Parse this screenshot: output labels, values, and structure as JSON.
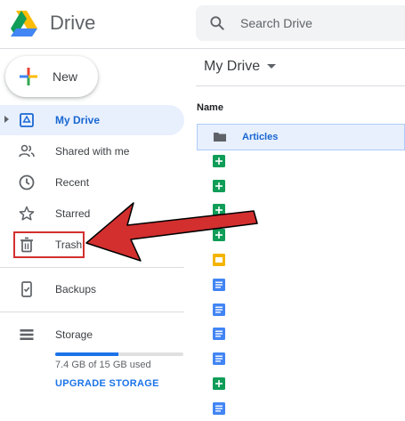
{
  "header": {
    "brand": "Drive",
    "logo_icon": "google-drive-logo",
    "search_placeholder": "Search Drive",
    "search_icon": "search-icon"
  },
  "sidebar": {
    "new_label": "New",
    "items": [
      {
        "label": "My Drive",
        "icon": "my-drive-icon",
        "active": true
      },
      {
        "label": "Shared with me",
        "icon": "people-icon"
      },
      {
        "label": "Recent",
        "icon": "clock-icon"
      },
      {
        "label": "Starred",
        "icon": "star-icon"
      },
      {
        "label": "Trash",
        "icon": "trash-icon",
        "highlighted": true
      },
      {
        "label": "Backups",
        "icon": "backup-icon"
      },
      {
        "label": "Storage",
        "icon": "storage-icon"
      }
    ],
    "storage": {
      "used_text": "7.4 GB of 15 GB used",
      "used_fraction": 0.49,
      "upgrade_label": "UPGRADE STORAGE"
    }
  },
  "main": {
    "title": "My Drive",
    "column_name": "Name",
    "files": [
      {
        "name": "Articles",
        "type": "folder",
        "selected": true
      },
      {
        "name": "",
        "type": "sheets"
      },
      {
        "name": "",
        "type": "sheets"
      },
      {
        "name": "",
        "type": "sheets"
      },
      {
        "name": "",
        "type": "sheets"
      },
      {
        "name": "",
        "type": "slides"
      },
      {
        "name": "",
        "type": "docs"
      },
      {
        "name": "",
        "type": "docs"
      },
      {
        "name": "",
        "type": "docs"
      },
      {
        "name": "",
        "type": "docs"
      },
      {
        "name": "",
        "type": "sheets"
      },
      {
        "name": "",
        "type": "docs"
      }
    ]
  },
  "colors": {
    "accent": "#1a73e8",
    "active_bg": "#e8f0fe",
    "sheets": "#0f9d58",
    "slides": "#f4b400",
    "docs": "#4285f4",
    "highlight": "#d32f2f"
  }
}
